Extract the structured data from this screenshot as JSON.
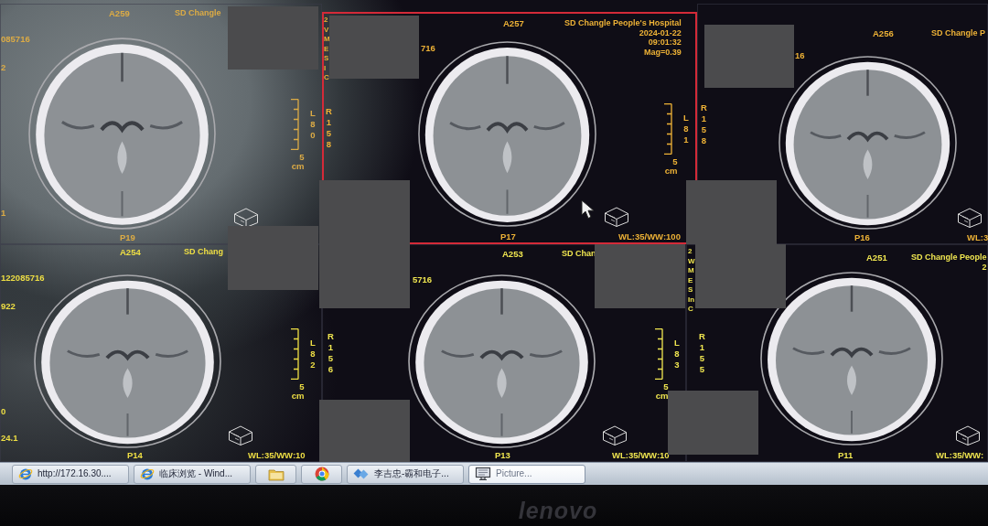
{
  "screen": {
    "panels": [
      {
        "selected": false,
        "pointer": false,
        "series": "A259",
        "header_lines": [
          "SD Changle"
        ],
        "info_lines": [
          "085716",
          "2"
        ],
        "lower_info_lines": [
          "1"
        ],
        "right_marker": "L80",
        "scale_label": "5 cm",
        "image_label": "P19"
      },
      {
        "selected": true,
        "pointer": true,
        "series": "A257",
        "header_lines": [
          "SD Changle People's Hospital",
          "2024-01-22",
          "09:01:32",
          "Mag=0.39"
        ],
        "side_fragments": [
          "2",
          "V",
          "M",
          "E",
          "S",
          "I",
          "C"
        ],
        "info_lines": [
          "716"
        ],
        "left_marker": "R158",
        "right_marker": "L81",
        "scale_label": "5 cm",
        "image_label": "P17",
        "window_level": "WL:35/WW:100"
      },
      {
        "selected": false,
        "pointer": false,
        "series": "A256",
        "header_lines": [
          "SD Changle P"
        ],
        "info_lines": [
          "16"
        ],
        "left_marker": "R158",
        "image_label": "P16",
        "window_level": "WL:3"
      },
      {
        "selected": false,
        "pointer": false,
        "series": "A254",
        "header_lines": [
          "SD Chang"
        ],
        "info_lines": [
          "122085716",
          "922"
        ],
        "lower_info_lines": [
          "0",
          "24.1"
        ],
        "right_marker": "L82",
        "scale_label": "5 cm",
        "image_label": "P14",
        "window_level": "WL:35/WW:10"
      },
      {
        "selected": false,
        "pointer": false,
        "series": "A253",
        "header_lines": [
          "SD Chan"
        ],
        "info_lines": [
          "5716"
        ],
        "left_marker": "R156",
        "right_marker": "L83",
        "scale_label": "5 cm",
        "image_label": "P13",
        "window_level": "WL:35/WW:10"
      },
      {
        "selected": false,
        "pointer": false,
        "series": "A251",
        "header_lines": [
          "SD Changle People",
          "2"
        ],
        "side_fragments": [
          "2",
          "W",
          "M",
          "E",
          "S",
          "In",
          "C"
        ],
        "left_marker": "R155",
        "image_label": "P11",
        "window_level": "WL:35/WW:"
      }
    ]
  },
  "taskbar": {
    "items": [
      {
        "kind": "browser",
        "label": "http://172.16.30....",
        "selected": false
      },
      {
        "kind": "browser",
        "label": "临床浏览 - Wind...",
        "selected": false
      },
      {
        "kind": "folder",
        "selected": false
      },
      {
        "kind": "chrome",
        "selected": false
      },
      {
        "kind": "app",
        "label": "李吉忠-霸和电子...",
        "selected": false
      },
      {
        "kind": "monitor",
        "label": "Picture...",
        "selected": true
      }
    ]
  },
  "bezel": {
    "logo": "lenovo"
  }
}
